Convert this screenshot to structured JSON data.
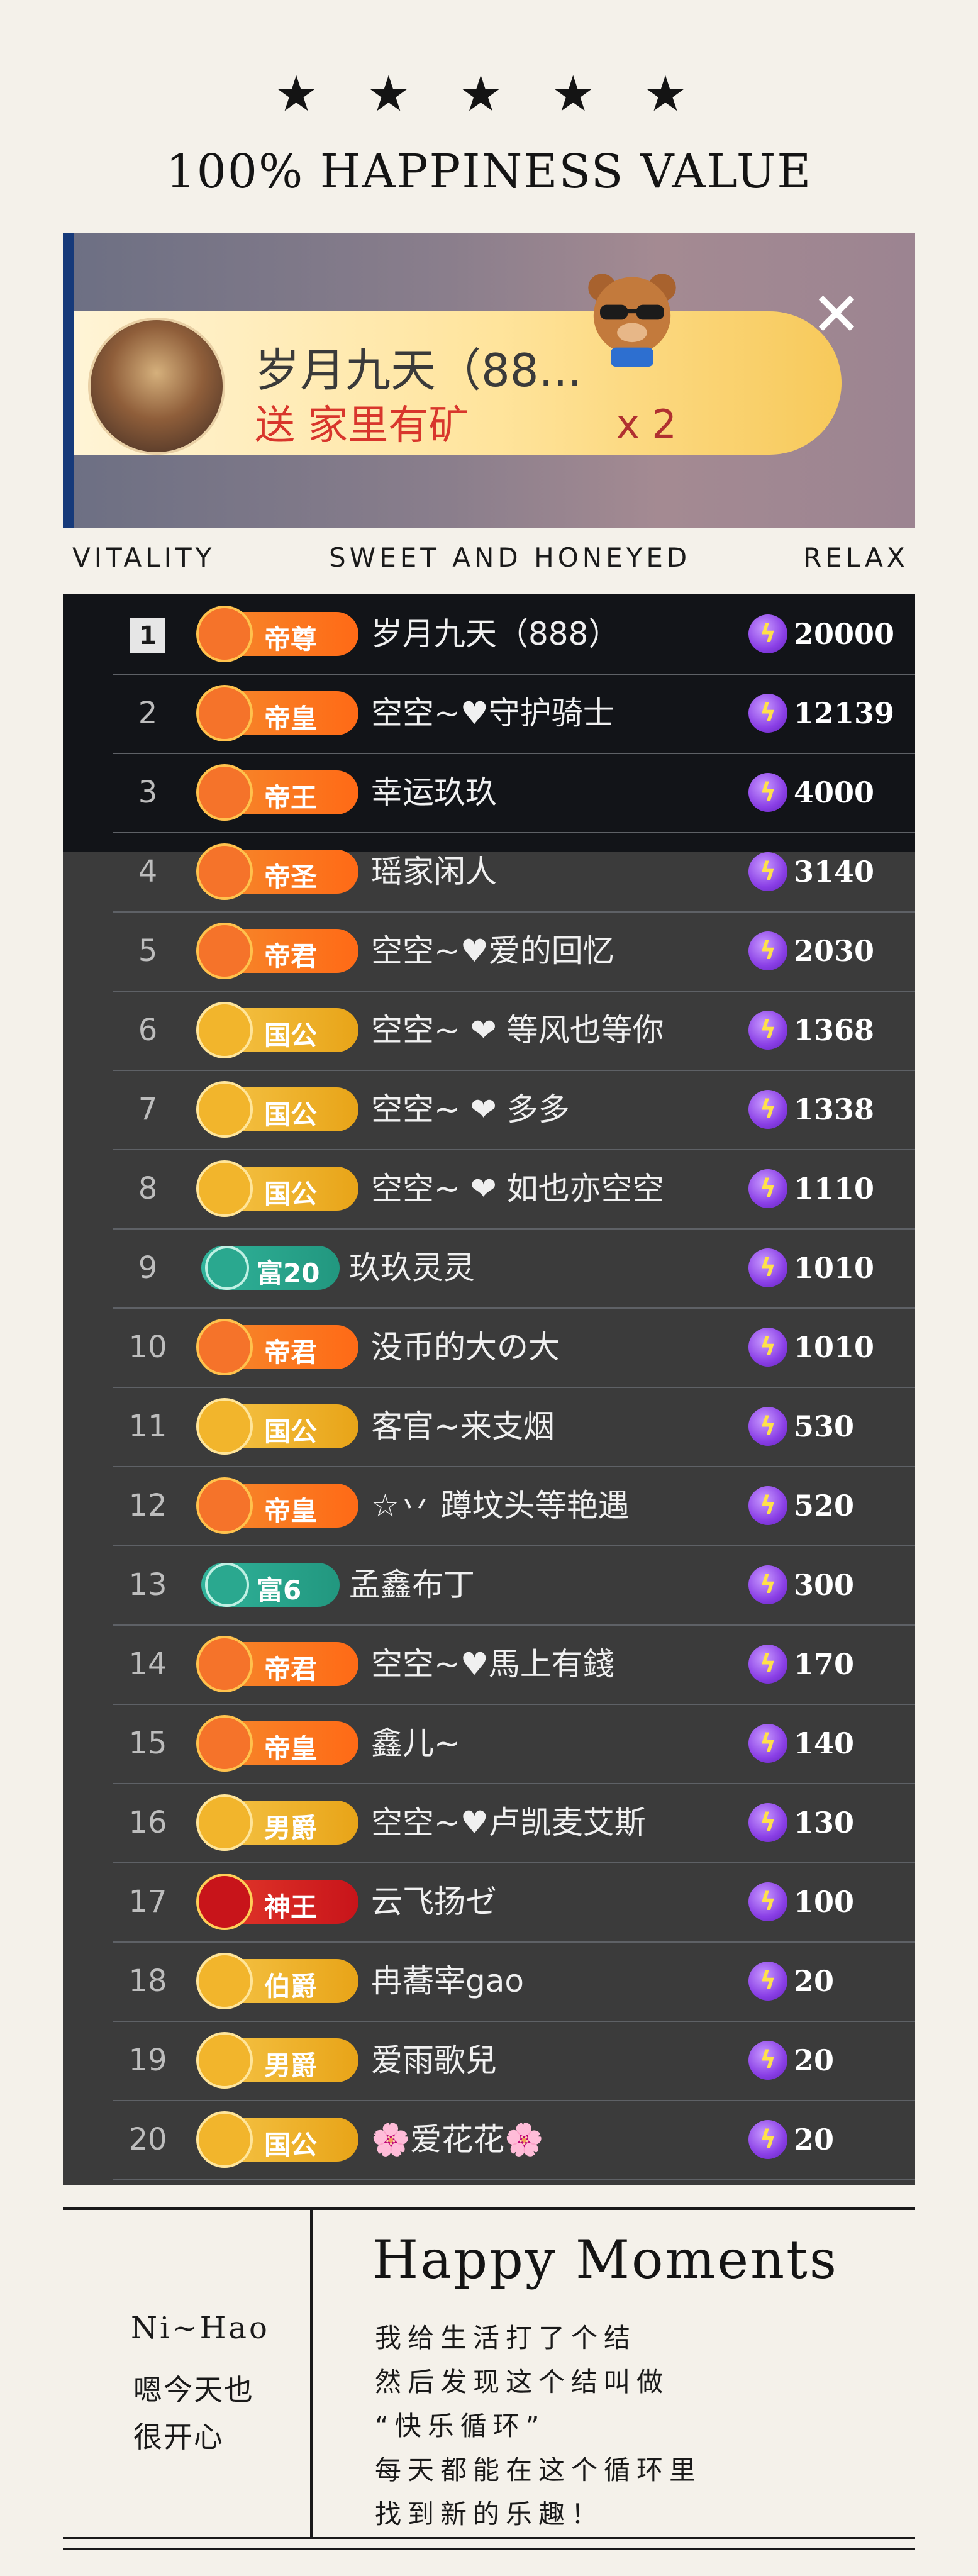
{
  "header": {
    "stars": "★ ★ ★ ★ ★",
    "title": "100% HAPPINESS VALUE"
  },
  "gift_banner": {
    "user": "岁月九天（88...",
    "gift_text": "送 家里有矿",
    "multiplier": "x 2",
    "close_icon": "close-icon",
    "bear_icon": "bear-sunglasses-icon"
  },
  "labels": {
    "left": "VITALITY",
    "center": "SWEET AND HONEYED",
    "right": "RELAX"
  },
  "ranking": {
    "currency_icon": "lightning-gem-icon",
    "rows": [
      {
        "rank": "1",
        "badge": "帝尊",
        "style": "orange",
        "name": "岁月九天（888）",
        "score": "20000"
      },
      {
        "rank": "2",
        "badge": "帝皇",
        "style": "orange",
        "name": "空空~♥守护骑士",
        "score": "12139"
      },
      {
        "rank": "3",
        "badge": "帝王",
        "style": "orange",
        "name": "幸运玖玖",
        "score": "4000"
      },
      {
        "rank": "4",
        "badge": "帝圣",
        "style": "orange",
        "name": "瑶家闲人",
        "score": "3140"
      },
      {
        "rank": "5",
        "badge": "帝君",
        "style": "orange",
        "name": "空空~♥爱的回忆",
        "score": "2030"
      },
      {
        "rank": "6",
        "badge": "国公",
        "style": "gold",
        "name": "空空~ ❤ 等风也等你",
        "score": "1368"
      },
      {
        "rank": "7",
        "badge": "国公",
        "style": "gold",
        "name": "空空~ ❤ 多多",
        "score": "1338"
      },
      {
        "rank": "8",
        "badge": "国公",
        "style": "gold",
        "name": "空空~ ❤ 如也亦空空",
        "score": "1110"
      },
      {
        "rank": "9",
        "badge": "富20",
        "style": "green",
        "name": "玖玖灵灵",
        "score": "1010"
      },
      {
        "rank": "10",
        "badge": "帝君",
        "style": "orange",
        "name": "没币的大の大",
        "score": "1010"
      },
      {
        "rank": "11",
        "badge": "国公",
        "style": "gold",
        "name": "客官~来支烟",
        "score": "530"
      },
      {
        "rank": "12",
        "badge": "帝皇",
        "style": "orange",
        "name": "☆丷 蹲坟头等艳遇",
        "score": "520"
      },
      {
        "rank": "13",
        "badge": "富6",
        "style": "green",
        "name": "孟鑫布丁",
        "score": "300"
      },
      {
        "rank": "14",
        "badge": "帝君",
        "style": "orange",
        "name": "空空~♥馬上有錢",
        "score": "170"
      },
      {
        "rank": "15",
        "badge": "帝皇",
        "style": "orange",
        "name": "鑫儿~",
        "score": "140"
      },
      {
        "rank": "16",
        "badge": "男爵",
        "style": "gold",
        "name": "空空~♥卢凯麦艾斯",
        "score": "130"
      },
      {
        "rank": "17",
        "badge": "神王",
        "style": "red",
        "name": "云飞扬ゼ",
        "score": "100"
      },
      {
        "rank": "18",
        "badge": "伯爵",
        "style": "gold",
        "name": "冉蕎宰gao",
        "score": "20"
      },
      {
        "rank": "19",
        "badge": "男爵",
        "style": "gold",
        "name": "爱雨歌兒",
        "score": "20"
      },
      {
        "rank": "20",
        "badge": "国公",
        "style": "gold",
        "name": "🌸爱花花🌸",
        "score": "20"
      }
    ]
  },
  "bottom": {
    "greeting": "Ni~Hao",
    "left_lines": [
      "嗯今天也",
      "很开心"
    ],
    "title": "Happy Moments",
    "lines": [
      "我给生活打了个结",
      "然后发现这个结叫做",
      "“快乐循环”",
      "每天都能在这个循环里",
      "找到新的乐趣！"
    ]
  }
}
